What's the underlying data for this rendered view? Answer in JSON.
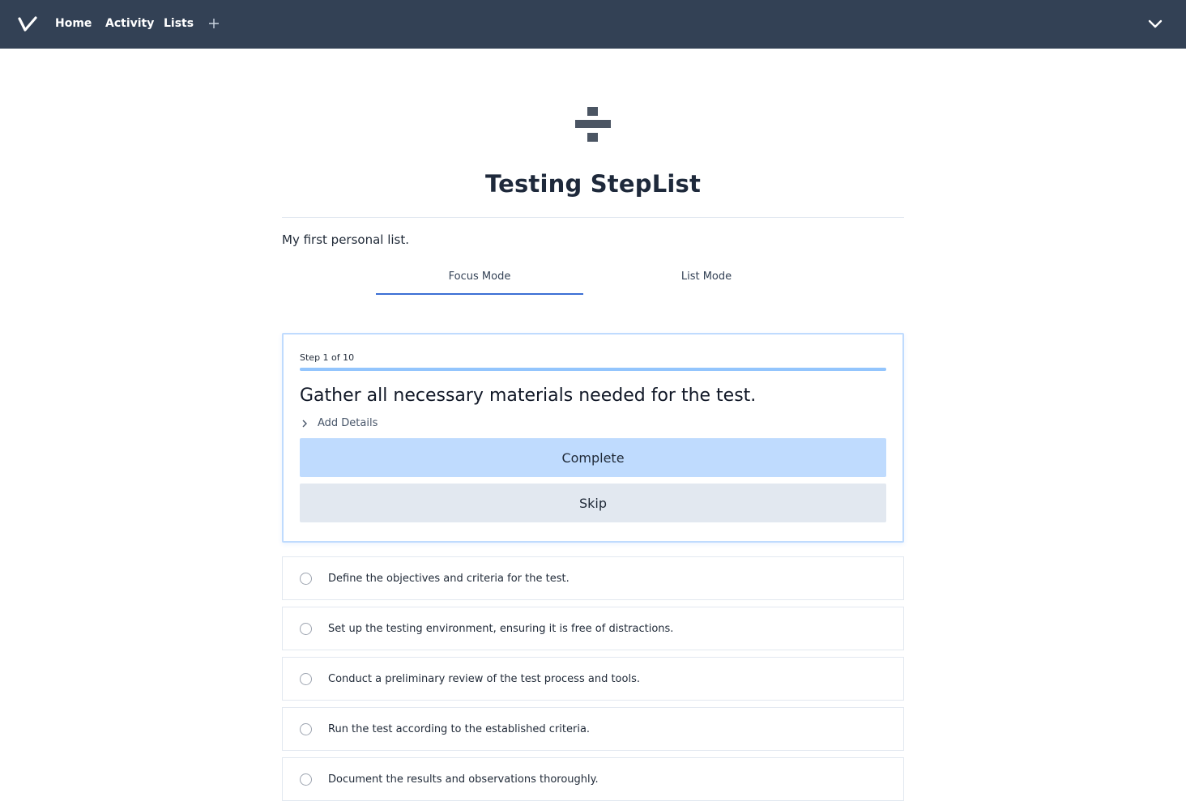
{
  "nav": {
    "logo_icon": "checkmark-logo-icon",
    "links": [
      "Home",
      "Activity",
      "Lists"
    ],
    "add_icon": "plus-icon",
    "menu_icon": "chevron-down-icon"
  },
  "list": {
    "icon": "divide-icon",
    "title": "Testing StepList",
    "description": "My first personal list."
  },
  "tabs": {
    "focus": "Focus Mode",
    "list": "List Mode",
    "active": "Focus Mode"
  },
  "focus_card": {
    "step_label": "Step 1 of 10",
    "progress": 0.1,
    "step_text": "Gather all necessary materials needed for the test.",
    "add_details": "Add Details",
    "complete_label": "Complete",
    "skip_label": "Skip"
  },
  "steps": [
    "Define the objectives and criteria for the test.",
    "Set up the testing environment, ensuring it is free of distractions.",
    "Conduct a preliminary review of the test process and tools.",
    "Run the test according to the established criteria.",
    "Document the results and observations thoroughly."
  ],
  "colors": {
    "nav_bg": "#334155",
    "accent": "#3b6fd4",
    "complete_bg": "#bfdbfe",
    "skip_bg": "#e2e8f0"
  }
}
